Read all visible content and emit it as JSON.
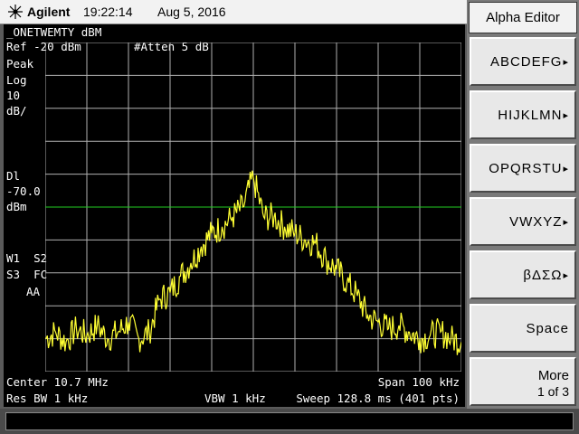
{
  "header": {
    "brand": "Agilent",
    "time": "19:22:14",
    "date": "Aug 5, 2016",
    "logo_icon": "agilent-spark-icon"
  },
  "screen": {
    "marker_line": "_ONETWEMTY dBM",
    "ref_level": "Ref -20 dBm",
    "attenuation": "#Atten 5 dB",
    "detector": "Peak",
    "scale_type": "Log",
    "scale_value": "10",
    "scale_unit": "dB/",
    "display_line_label": "Dl",
    "display_line_value": "-70.0",
    "display_line_unit": "dBm",
    "trace_row1": "W1  S2",
    "trace_row2": "S3  FC",
    "trace_row3": "AA",
    "center": "Center 10.7 MHz",
    "span": "Span 100 kHz",
    "res_bw": "Res BW 1 kHz",
    "vbw": "VBW 1 kHz",
    "sweep": "Sweep 128.8 ms (401 pts)"
  },
  "softkeys": {
    "title": "Alpha Editor",
    "keys": [
      {
        "label": "ABCDEFG",
        "arrow": "▸"
      },
      {
        "label": "HIJKLMN",
        "arrow": "▸"
      },
      {
        "label": "OPQRSTU",
        "arrow": "▸"
      },
      {
        "label": "VWXYZ",
        "arrow": "▸"
      },
      {
        "label": "βΔΣΩ",
        "arrow": "▸"
      },
      {
        "label": "Space",
        "arrow": ""
      }
    ],
    "more_label": "More",
    "more_page": "1 of 3"
  },
  "colors": {
    "trace": "#ffff33",
    "display_line": "#22cc22",
    "grid": "#b0b0b0",
    "background": "#000000"
  },
  "chart_data": {
    "type": "line",
    "xlabel": "",
    "ylabel": "",
    "xlim": [
      10.65,
      10.75
    ],
    "ylim": [
      -120,
      -20
    ],
    "x_unit": "MHz",
    "y_unit": "dBm",
    "display_line": -70.0,
    "series": [
      {
        "x": [
          10.65,
          10.6525,
          10.655,
          10.6575,
          10.66,
          10.6625,
          10.665,
          10.6675,
          10.67,
          10.6725,
          10.675,
          10.6775,
          10.68,
          10.6825,
          10.685,
          10.6875,
          10.69,
          10.6925,
          10.695,
          10.6975,
          10.7,
          10.7025,
          10.705,
          10.7075,
          10.71,
          10.7125,
          10.715,
          10.7175,
          10.72,
          10.7225,
          10.725,
          10.7275,
          10.73,
          10.7325,
          10.735,
          10.7375,
          10.74,
          10.7425,
          10.745,
          10.7475,
          10.75
        ],
        "values": [
          -110,
          -108,
          -111,
          -107,
          -109,
          -106,
          -110,
          -108,
          -105,
          -110,
          -108,
          -98,
          -96,
          -91,
          -87,
          -82,
          -78,
          -76,
          -73,
          -70,
          -61,
          -73,
          -73,
          -76,
          -78,
          -80,
          -81,
          -86,
          -89,
          -93,
          -97,
          -103,
          -105,
          -107,
          -106,
          -108,
          -110,
          -109,
          -108,
          -110,
          -111
        ]
      }
    ]
  }
}
